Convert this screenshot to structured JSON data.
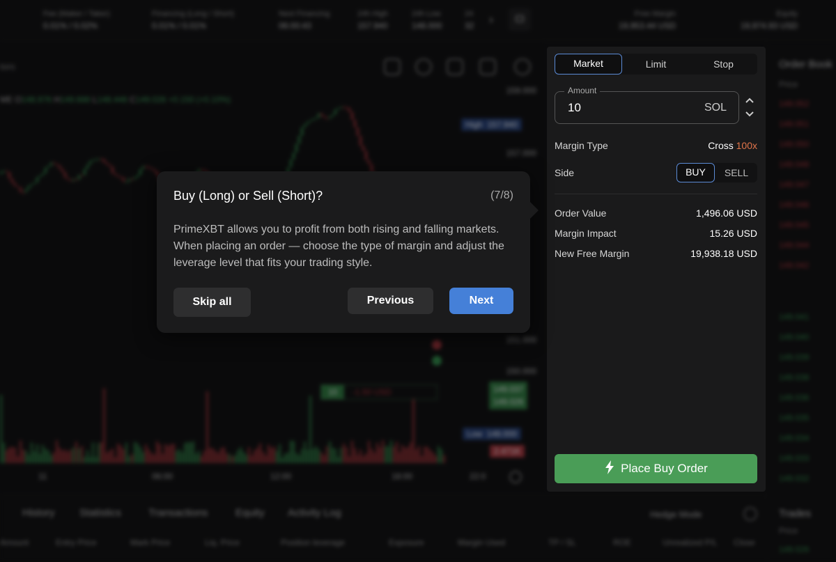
{
  "topbar": {
    "stats": [
      {
        "label": "Fee (Maker / Taker)",
        "value": "0.01% / 0.02%"
      },
      {
        "label": "Financing (Long / Short)",
        "value": "0.01% / 0.01%"
      },
      {
        "label": "Next Financing",
        "value": "06:00:43"
      },
      {
        "label": "24h High",
        "value": "157.940"
      },
      {
        "label": "24h Low",
        "value": "148.000"
      },
      {
        "label": "24",
        "value": "32"
      }
    ],
    "free_margin": {
      "label": "Free Margin",
      "value": "19,953.44 USD"
    },
    "equity": {
      "label": "Equity",
      "value": "19,974.93 USD"
    }
  },
  "chart": {
    "indicators_label": "tors",
    "ohlc": {
      "symbol": "ME",
      "o": "148.976",
      "h": "149.688",
      "l": "148.446",
      "c": "149.026",
      "change": "+0.150 (+0.10%)"
    },
    "y_ticks": [
      "159.000",
      "157.000",
      "151.000",
      "150.000"
    ],
    "x_ticks": [
      "11",
      "06:00",
      "12:00",
      "18:00",
      "22:0"
    ],
    "high_tag": {
      "label": "High",
      "value": "157.940"
    },
    "low_tag": {
      "label": "Low",
      "value": "148.000"
    },
    "price_tags": [
      "149.037",
      "149.026"
    ],
    "volume_tag": "2.471K",
    "position_tag": {
      "qty": "10",
      "pnl": "-1.50 USD"
    },
    "colors": {
      "up": "#2f8f4a",
      "down": "#b4333a"
    }
  },
  "order_panel": {
    "order_types": [
      "Market",
      "Limit",
      "Stop"
    ],
    "selected_order_type": "Market",
    "amount": {
      "label": "Amount",
      "value": "10",
      "unit": "SOL"
    },
    "margin_type": {
      "label": "Margin Type",
      "value": "Cross",
      "leverage": "100x"
    },
    "side": {
      "label": "Side",
      "options": [
        "BUY",
        "SELL"
      ],
      "selected": "BUY"
    },
    "summary": [
      {
        "label": "Order Value",
        "value": "1,496.06 USD"
      },
      {
        "label": "Margin Impact",
        "value": "15.26 USD"
      },
      {
        "label": "New Free Margin",
        "value": "19,938.18 USD"
      }
    ],
    "place_button": "Place Buy Order"
  },
  "tour": {
    "title": "Buy (Long) or Sell (Short)?",
    "step": "(7/8)",
    "body": "PrimeXBT allows you to profit from both rising and falling markets. When placing an order — choose the type of margin and adjust the leverage level that fits your trading style.",
    "skip": "Skip all",
    "previous": "Previous",
    "next": "Next"
  },
  "order_book": {
    "title": "Order Book",
    "price_header": "Price",
    "asks": [
      "149.052",
      "149.051",
      "149.050",
      "149.048",
      "149.047",
      "149.046",
      "149.045",
      "149.044",
      "149.042"
    ],
    "bids": [
      "149.041",
      "149.040",
      "149.039",
      "149.038",
      "149.036",
      "149.035",
      "149.034",
      "149.033",
      "149.032"
    ]
  },
  "trades": {
    "title": "Trades",
    "price_header": "Price",
    "first": "149.026"
  },
  "bottom": {
    "tabs": [
      "History",
      "Statistics",
      "Transactions",
      "Equity",
      "Activity Log"
    ],
    "hedge_mode": "Hedge Mode",
    "columns": [
      "Amount",
      "Entry Price",
      "Mark Price",
      "Liq. Price",
      "Position leverage",
      "Exposure",
      "Margin Used",
      "TP / SL",
      "ROE",
      "Unrealized P/L",
      "Close"
    ]
  }
}
